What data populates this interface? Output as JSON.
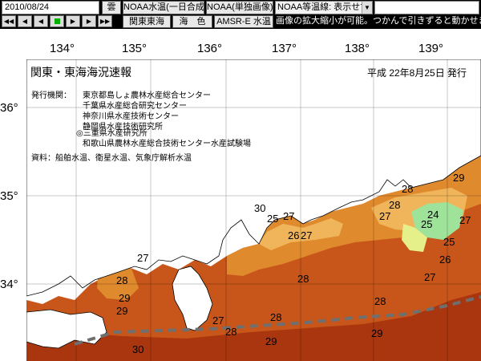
{
  "toolbar": {
    "date_value": "2010/08/24",
    "weather_icon_label": "雲",
    "product_select": "NOAA水温(一日合成)",
    "single_image_button": "NOAA(単独画像)",
    "isotherm_select": "NOAA等温線: 表示せず",
    "dropdown_icon": "chevron-down-icon",
    "region_button": "関東東海",
    "ocean_color_button": "海　色",
    "amsr_button": "AMSR-E 水温",
    "nav_buttons": [
      "first-icon",
      "prev-fast-icon",
      "prev-icon",
      "play-icon",
      "next-icon",
      "next-fast-icon",
      "last-icon"
    ],
    "hint_text": "画像の拡大縮小が可能。つかんで引きずると動かせます。"
  },
  "map": {
    "title": "関東・東海海況速報",
    "issue_date": "平成 22年8月25日 発行",
    "issuer_label": "発行機関：",
    "issuers": [
      "東京都島しょ農林水産総合センター",
      "千葉県水産総合研究センター",
      "神奈川県水産技術センター",
      "静岡県水産技術研究所",
      "◎三重県水産研究所",
      "和歌山県農林水産総合技術センター水産試験場"
    ],
    "source": "資料：船舶水温、衛星水温、気象庁解析水温",
    "longitudes": [
      "134°",
      "135°",
      "136°",
      "137°",
      "138°",
      "139°"
    ],
    "latitudes": [
      "36°",
      "35°",
      "34°"
    ],
    "isotherm_labels": [
      "27",
      "28",
      "29",
      "30",
      "25",
      "27",
      "26",
      "27",
      "28",
      "29",
      "28",
      "27",
      "25",
      "24",
      "27",
      "25",
      "26",
      "27",
      "28",
      "28",
      "28",
      "29",
      "27",
      "28",
      "29",
      "30",
      "29"
    ],
    "colors": {
      "sea_warm": "#c8561a",
      "sea_hot": "#a9360e",
      "sea_mid": "#e08a2e",
      "sea_cool": "#f0b55a",
      "sea_cold": "#9fe29a",
      "land": "#ffffff",
      "kuroshio_line": "#6f6f6f"
    }
  }
}
